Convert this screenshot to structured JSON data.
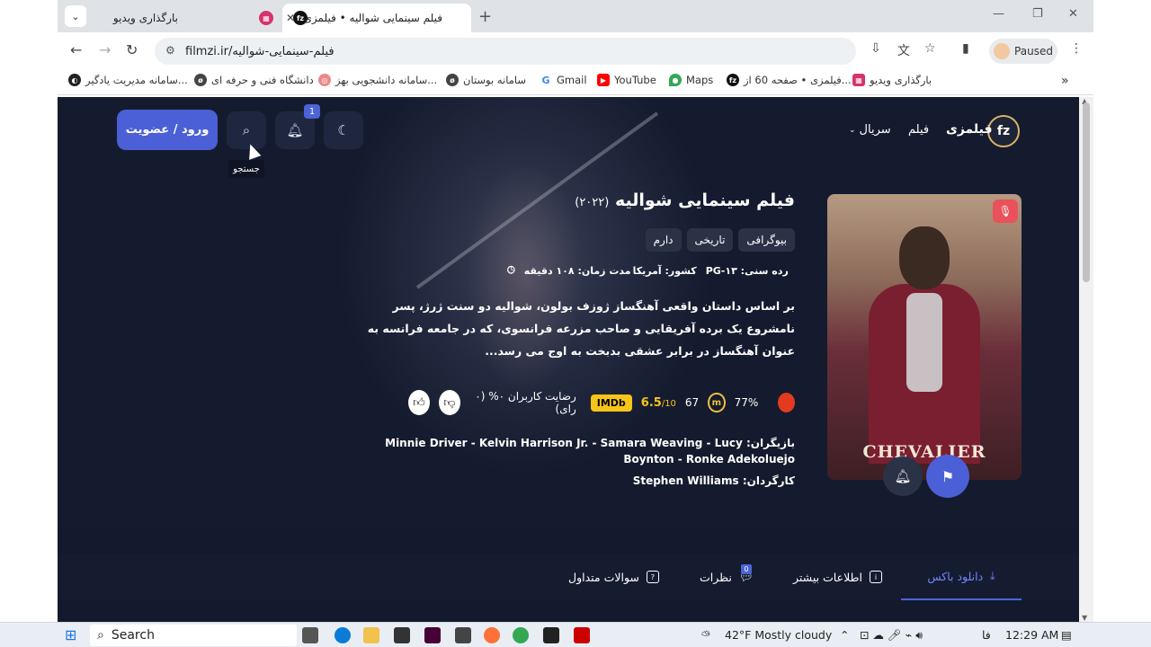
{
  "browser": {
    "tabs": [
      {
        "title": "بارگذاری ویدیو",
        "active": false
      },
      {
        "title": "فیلم سینمایی شوالیه • فیلمزی",
        "active": true
      }
    ],
    "url": "filmzi.ir/فیلم-سینمایی-شوالیه",
    "profile_label": "Paused",
    "bookmarks": [
      "سامانه مدیریت یادگیر...",
      "دانشگاه فنی و حرفه ای",
      "سامانه دانشجویی بهز...",
      "سامانه بوستان",
      "Gmail",
      "YouTube",
      "Maps",
      "فیلمزی • صفحه 60 از...",
      "بارگذاری ویدیو"
    ]
  },
  "site": {
    "brand": "فیلمزی",
    "logo": "fz",
    "nav": {
      "film": "فیلم",
      "series": "سریال"
    },
    "notif_count": "1",
    "login_label": "ورود / عضویت",
    "search_tooltip": "جستجو"
  },
  "movie": {
    "title": "فیلم سینمایی شوالیه",
    "year": "(۲۰۲۲)",
    "genres": [
      "بیوگرافی",
      "تاریخی",
      "دارم"
    ],
    "duration": "مدت زمان: ۱۰۸ دقیقه",
    "country": "کشور: آمریکا",
    "age_rating": "رده سنی: PG-۱۳",
    "description": "بر اساس داستان واقعی آهنگساز ژوزف بولون، شوالیه دو سنت ژرژ، پسر نامشروع یک برده آفریقایی و صاحب مزرعه فرانسوی، که در جامعه فرانسه به عنوان آهنگساز در برابر عشقی بدبخت به اوج می رسد...",
    "user_rating": "رضایت کاربران ۰% (۰ رای)",
    "imdb_label": "IMDb",
    "imdb_score": "6.5",
    "imdb_max": "/10",
    "metacritic": "67",
    "rotten": "77%",
    "cast_label": "بازیگران:",
    "cast": "Minnie Driver - Kelvin Harrison Jr. - Samara Weaving - Lucy Boynton - Ronke Adekoluejo",
    "director_label": "کارگردان:",
    "director": "Stephen Williams",
    "poster_title": "CHEVALIER"
  },
  "page_tabs": [
    {
      "label": "دانلود باکس",
      "active": true
    },
    {
      "label": "اطلاعات بیشتر",
      "active": false
    },
    {
      "label": "نظرات",
      "active": false,
      "badge": "0"
    },
    {
      "label": "سوالات متداول",
      "active": false
    }
  ],
  "taskbar": {
    "search_label": "Search",
    "weather": "42°F  Mostly cloudy",
    "lang": "فا",
    "time": "12:29 AM"
  }
}
